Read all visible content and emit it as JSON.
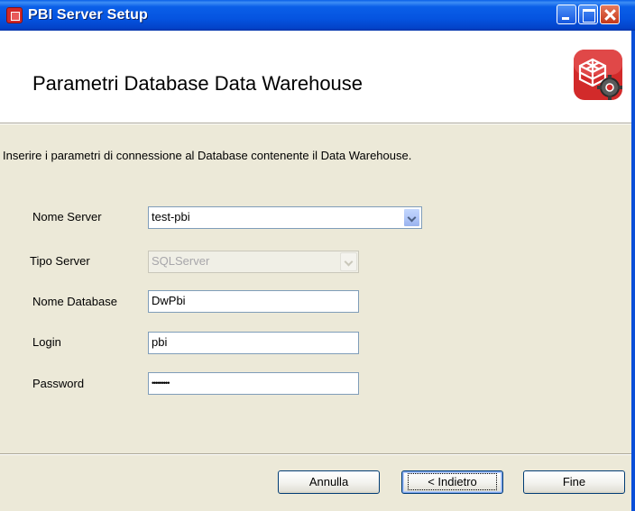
{
  "window": {
    "title": "PBI Server Setup"
  },
  "header": {
    "title": "Parametri Database Data Warehouse",
    "logo_icon": "cube-gear-icon"
  },
  "instructions": "Inserire i parametri di connessione al Database contenente il Data Warehouse.",
  "form": {
    "server_name": {
      "label": "Nome Server",
      "value": "test-pbi"
    },
    "server_type": {
      "label": "Tipo Server",
      "value": "SQLServer",
      "disabled": true
    },
    "database_name": {
      "label": "Nome Database",
      "value": "DwPbi"
    },
    "login": {
      "label": "Login",
      "value": "pbi"
    },
    "password": {
      "label": "Password",
      "value": "•••••••••"
    }
  },
  "buttons": {
    "cancel": "Annulla",
    "back": "< Indietro",
    "finish": "Fine"
  },
  "colors": {
    "titlebar": "#0a5fe8",
    "dialog_bg": "#ece9d8",
    "logo_red": "#d22a2a"
  }
}
